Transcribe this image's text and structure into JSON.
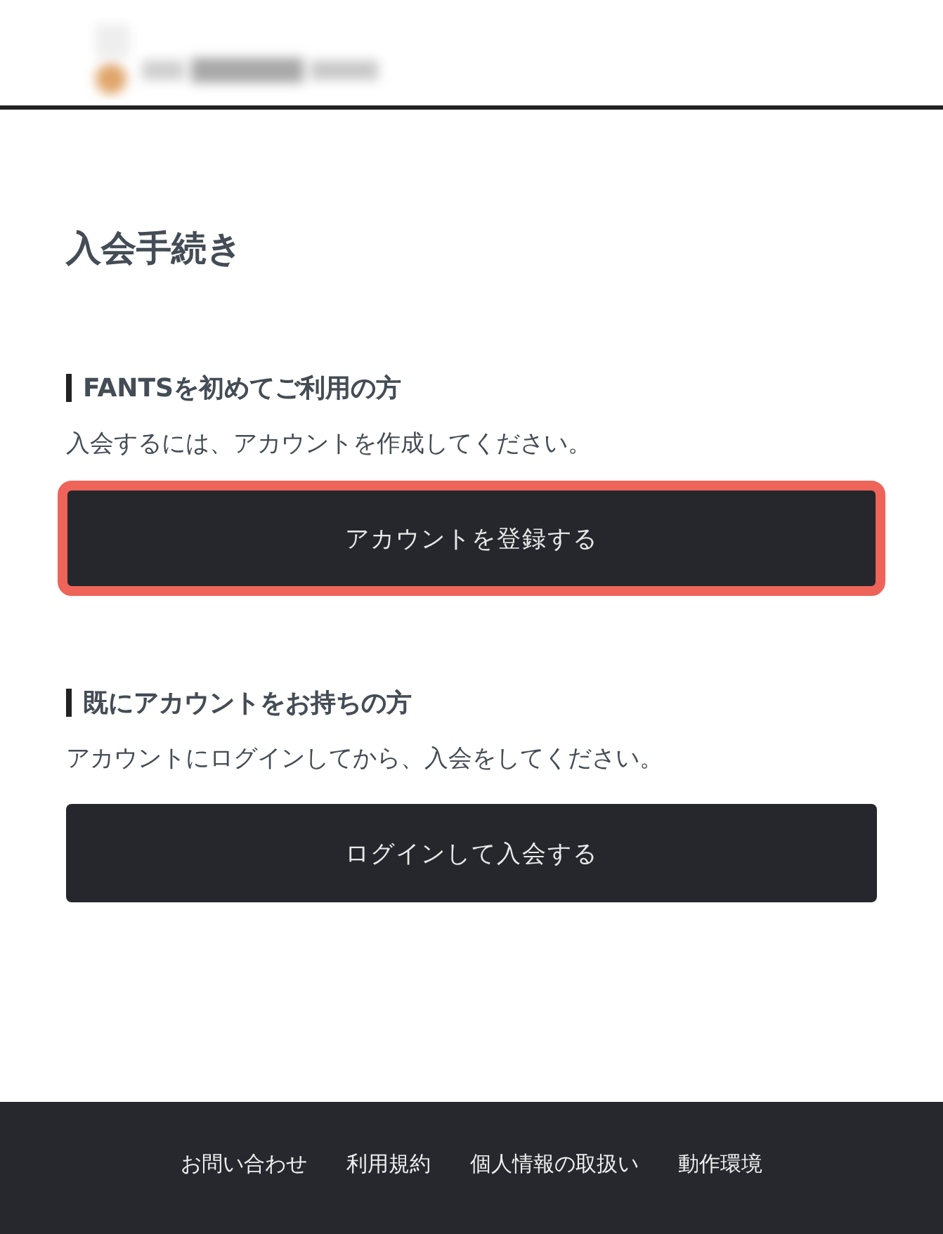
{
  "page_title": "入会手続き",
  "sections": [
    {
      "heading": "FANTSを初めてご利用の方",
      "description": "入会するには、アカウントを作成してください。",
      "button": {
        "label": "アカウントを登録する",
        "highlighted": true
      }
    },
    {
      "heading": "既にアカウントをお持ちの方",
      "description": "アカウントにログインしてから、入会をしてください。",
      "button": {
        "label": "ログインして入会する",
        "highlighted": false
      }
    }
  ],
  "footer": {
    "links": [
      "お問い合わせ",
      "利用規約",
      "個人情報の取扱い",
      "動作環境"
    ]
  }
}
